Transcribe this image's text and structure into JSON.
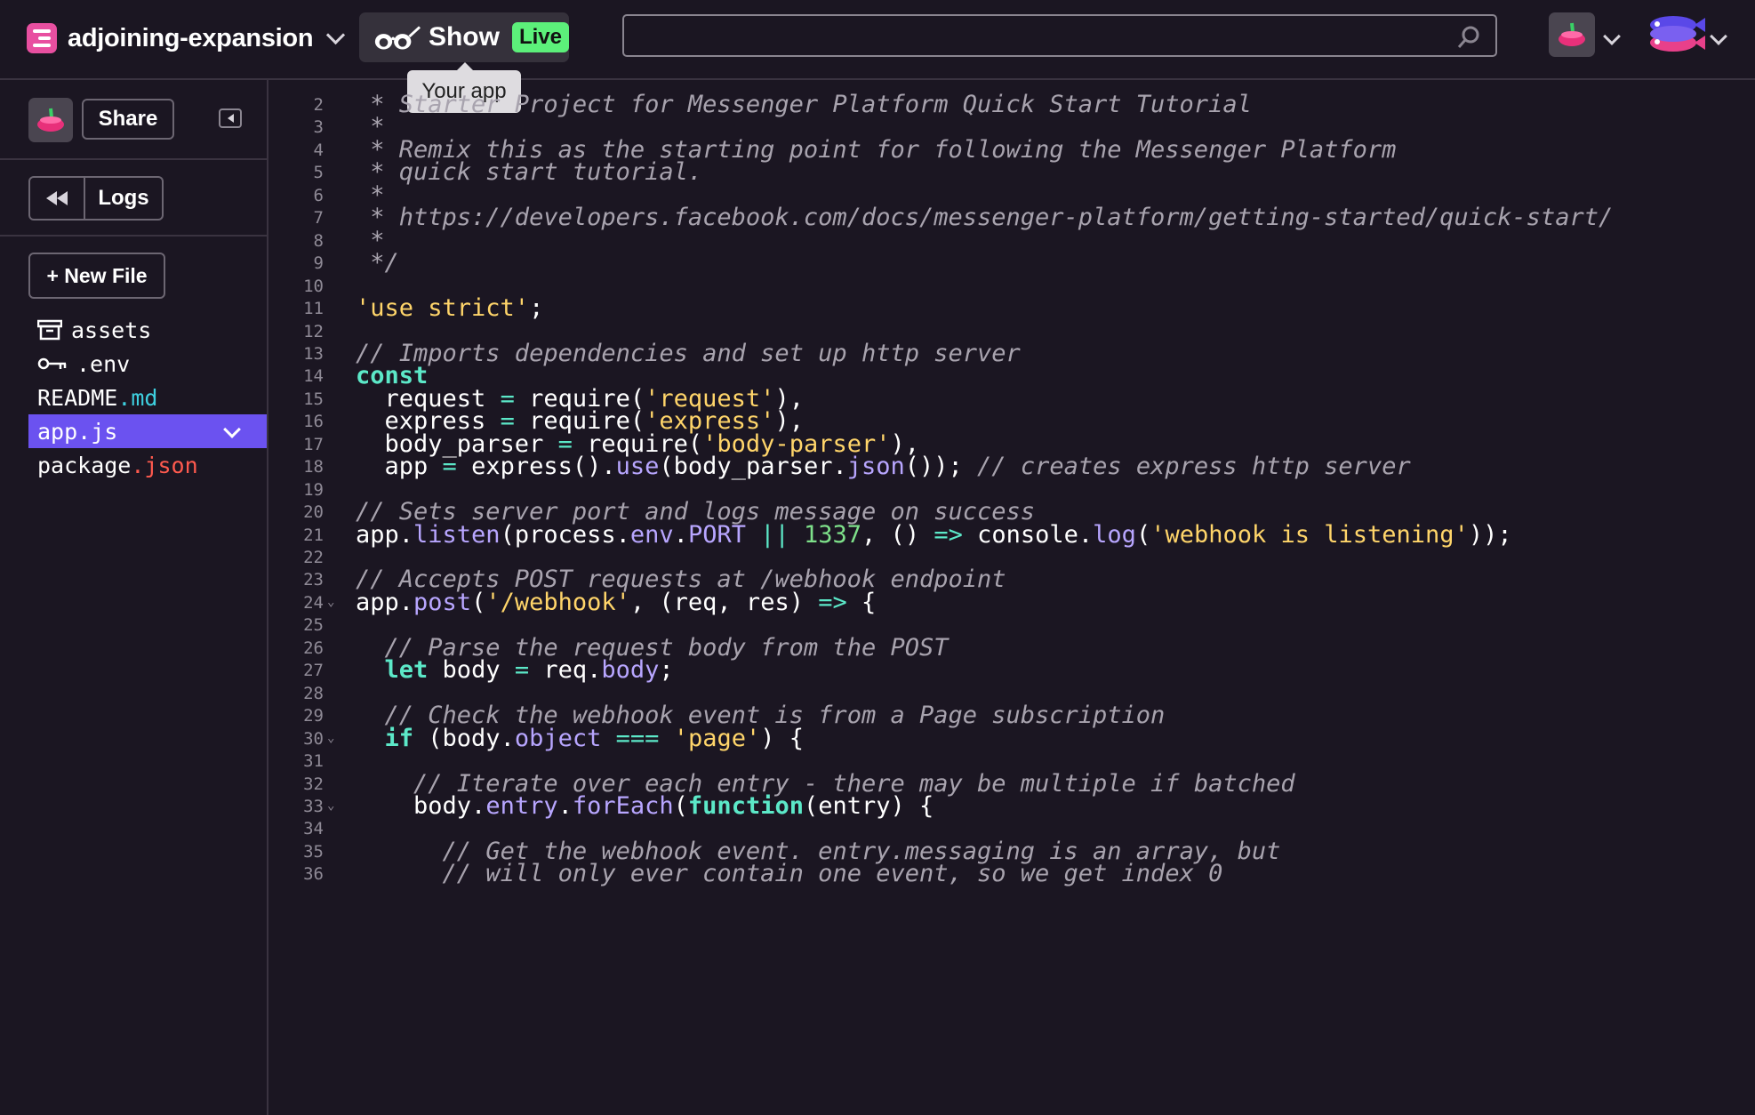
{
  "header": {
    "project_name": "adjoining-expansion",
    "show_label": "Show",
    "live_label": "Live",
    "tooltip": "Your app",
    "search_placeholder": ""
  },
  "sidebar": {
    "share_label": "Share",
    "logs_label": "Logs",
    "new_file_label": "+ New File",
    "files": [
      {
        "base": "assets",
        "ext": "",
        "icon": "archive-icon"
      },
      {
        "base": ".env",
        "ext": "",
        "icon": "key-icon"
      },
      {
        "base": "README",
        "ext": ".md",
        "icon": ""
      },
      {
        "base": "app.js",
        "ext": "",
        "icon": "",
        "active": true
      },
      {
        "base": "package",
        "ext": ".json",
        "icon": ""
      }
    ]
  },
  "editor": {
    "file": "app.js",
    "lines": [
      {
        "n": "2",
        "fold": false,
        "tokens": [
          [
            "cm",
            " * Starter Project for Messenger Platform Quick Start Tutorial"
          ]
        ]
      },
      {
        "n": "3",
        "fold": false,
        "tokens": [
          [
            "cm",
            " *"
          ]
        ]
      },
      {
        "n": "4",
        "fold": false,
        "tokens": [
          [
            "cm",
            " * Remix this as the starting point for following the Messenger Platform"
          ]
        ]
      },
      {
        "n": "5",
        "fold": false,
        "tokens": [
          [
            "cm",
            " * quick start tutorial."
          ]
        ]
      },
      {
        "n": "6",
        "fold": false,
        "tokens": [
          [
            "cm",
            " *"
          ]
        ]
      },
      {
        "n": "7",
        "fold": false,
        "tokens": [
          [
            "cm",
            " * https://developers.facebook.com/docs/messenger-platform/getting-started/quick-start/"
          ]
        ]
      },
      {
        "n": "8",
        "fold": false,
        "tokens": [
          [
            "cm",
            " *"
          ]
        ]
      },
      {
        "n": "9",
        "fold": false,
        "tokens": [
          [
            "cm",
            " */"
          ]
        ]
      },
      {
        "n": "10",
        "fold": false,
        "tokens": []
      },
      {
        "n": "11",
        "fold": false,
        "tokens": [
          [
            "str",
            "'use strict'"
          ],
          [
            "",
            ";"
          ]
        ]
      },
      {
        "n": "12",
        "fold": false,
        "tokens": []
      },
      {
        "n": "13",
        "fold": false,
        "tokens": [
          [
            "cm",
            "// Imports dependencies and set up http server"
          ]
        ]
      },
      {
        "n": "14",
        "fold": false,
        "tokens": [
          [
            "kw",
            "const"
          ]
        ]
      },
      {
        "n": "15",
        "fold": false,
        "tokens": [
          [
            "",
            "  request "
          ],
          [
            "op",
            "="
          ],
          [
            "",
            " require("
          ],
          [
            "str",
            "'request'"
          ],
          [
            "",
            "),"
          ]
        ]
      },
      {
        "n": "16",
        "fold": false,
        "tokens": [
          [
            "",
            "  express "
          ],
          [
            "op",
            "="
          ],
          [
            "",
            " require("
          ],
          [
            "str",
            "'express'"
          ],
          [
            "",
            "),"
          ]
        ]
      },
      {
        "n": "17",
        "fold": false,
        "tokens": [
          [
            "",
            "  body_parser "
          ],
          [
            "op",
            "="
          ],
          [
            "",
            " require("
          ],
          [
            "str",
            "'body-parser'"
          ],
          [
            "",
            "),"
          ]
        ]
      },
      {
        "n": "18",
        "fold": false,
        "tokens": [
          [
            "",
            "  app "
          ],
          [
            "op",
            "="
          ],
          [
            "",
            " express()."
          ],
          [
            "prop",
            "use"
          ],
          [
            "",
            "(body_parser."
          ],
          [
            "prop",
            "json"
          ],
          [
            "",
            "()); "
          ],
          [
            "cm",
            "// creates express http server"
          ]
        ]
      },
      {
        "n": "19",
        "fold": false,
        "tokens": []
      },
      {
        "n": "20",
        "fold": false,
        "tokens": [
          [
            "cm",
            "// Sets server port and logs message on success"
          ]
        ]
      },
      {
        "n": "21",
        "fold": false,
        "tokens": [
          [
            "",
            "app."
          ],
          [
            "prop",
            "listen"
          ],
          [
            "",
            "(process."
          ],
          [
            "prop",
            "env"
          ],
          [
            "",
            "."
          ],
          [
            "prop",
            "PORT"
          ],
          [
            "",
            " "
          ],
          [
            "op",
            "||"
          ],
          [
            "",
            " "
          ],
          [
            "num",
            "1337"
          ],
          [
            "",
            ", () "
          ],
          [
            "op",
            "=>"
          ],
          [
            "",
            " console."
          ],
          [
            "prop",
            "log"
          ],
          [
            "",
            "("
          ],
          [
            "str",
            "'webhook is listening'"
          ],
          [
            "",
            "));"
          ]
        ]
      },
      {
        "n": "22",
        "fold": false,
        "tokens": []
      },
      {
        "n": "23",
        "fold": false,
        "tokens": [
          [
            "cm",
            "// Accepts POST requests at /webhook endpoint"
          ]
        ]
      },
      {
        "n": "24",
        "fold": true,
        "tokens": [
          [
            "",
            "app."
          ],
          [
            "prop",
            "post"
          ],
          [
            "",
            "("
          ],
          [
            "str",
            "'/webhook'"
          ],
          [
            "",
            ", (req, res) "
          ],
          [
            "op",
            "=>"
          ],
          [
            "",
            " {"
          ]
        ]
      },
      {
        "n": "25",
        "fold": false,
        "tokens": []
      },
      {
        "n": "26",
        "fold": false,
        "tokens": [
          [
            "",
            "  "
          ],
          [
            "cm",
            "// Parse the request body from the POST"
          ]
        ]
      },
      {
        "n": "27",
        "fold": false,
        "tokens": [
          [
            "",
            "  "
          ],
          [
            "kw",
            "let"
          ],
          [
            "",
            " body "
          ],
          [
            "op",
            "="
          ],
          [
            "",
            " req."
          ],
          [
            "prop",
            "body"
          ],
          [
            "",
            ";"
          ]
        ]
      },
      {
        "n": "28",
        "fold": false,
        "tokens": []
      },
      {
        "n": "29",
        "fold": false,
        "tokens": [
          [
            "",
            "  "
          ],
          [
            "cm",
            "// Check the webhook event is from a Page subscription"
          ]
        ]
      },
      {
        "n": "30",
        "fold": true,
        "tokens": [
          [
            "",
            "  "
          ],
          [
            "kw",
            "if"
          ],
          [
            "",
            " (body."
          ],
          [
            "prop",
            "object"
          ],
          [
            "",
            " "
          ],
          [
            "op",
            "==="
          ],
          [
            "",
            " "
          ],
          [
            "str",
            "'page'"
          ],
          [
            "",
            ") {"
          ]
        ]
      },
      {
        "n": "31",
        "fold": false,
        "tokens": []
      },
      {
        "n": "32",
        "fold": false,
        "tokens": [
          [
            "",
            "    "
          ],
          [
            "cm",
            "// Iterate over each entry - there may be multiple if batched"
          ]
        ]
      },
      {
        "n": "33",
        "fold": true,
        "tokens": [
          [
            "",
            "    body."
          ],
          [
            "prop",
            "entry"
          ],
          [
            "",
            "."
          ],
          [
            "prop",
            "forEach"
          ],
          [
            "",
            "("
          ],
          [
            "kw",
            "function"
          ],
          [
            "",
            "(entry) {"
          ]
        ]
      },
      {
        "n": "34",
        "fold": false,
        "tokens": []
      },
      {
        "n": "35",
        "fold": false,
        "tokens": [
          [
            "",
            "      "
          ],
          [
            "cm",
            "// Get the webhook event. entry.messaging is an array, but"
          ]
        ]
      },
      {
        "n": "36",
        "fold": false,
        "tokens": [
          [
            "",
            "      "
          ],
          [
            "cm",
            "// will only ever contain one event, so we get index 0"
          ]
        ]
      }
    ]
  },
  "colors": {
    "background": "#1b1622",
    "accent_active_file": "#6b52f0",
    "live_badge": "#5cf07a",
    "keyword": "#5ce8c8",
    "string": "#ffd56a",
    "property": "#b8a6ff",
    "comment": "#a8a3ae"
  }
}
